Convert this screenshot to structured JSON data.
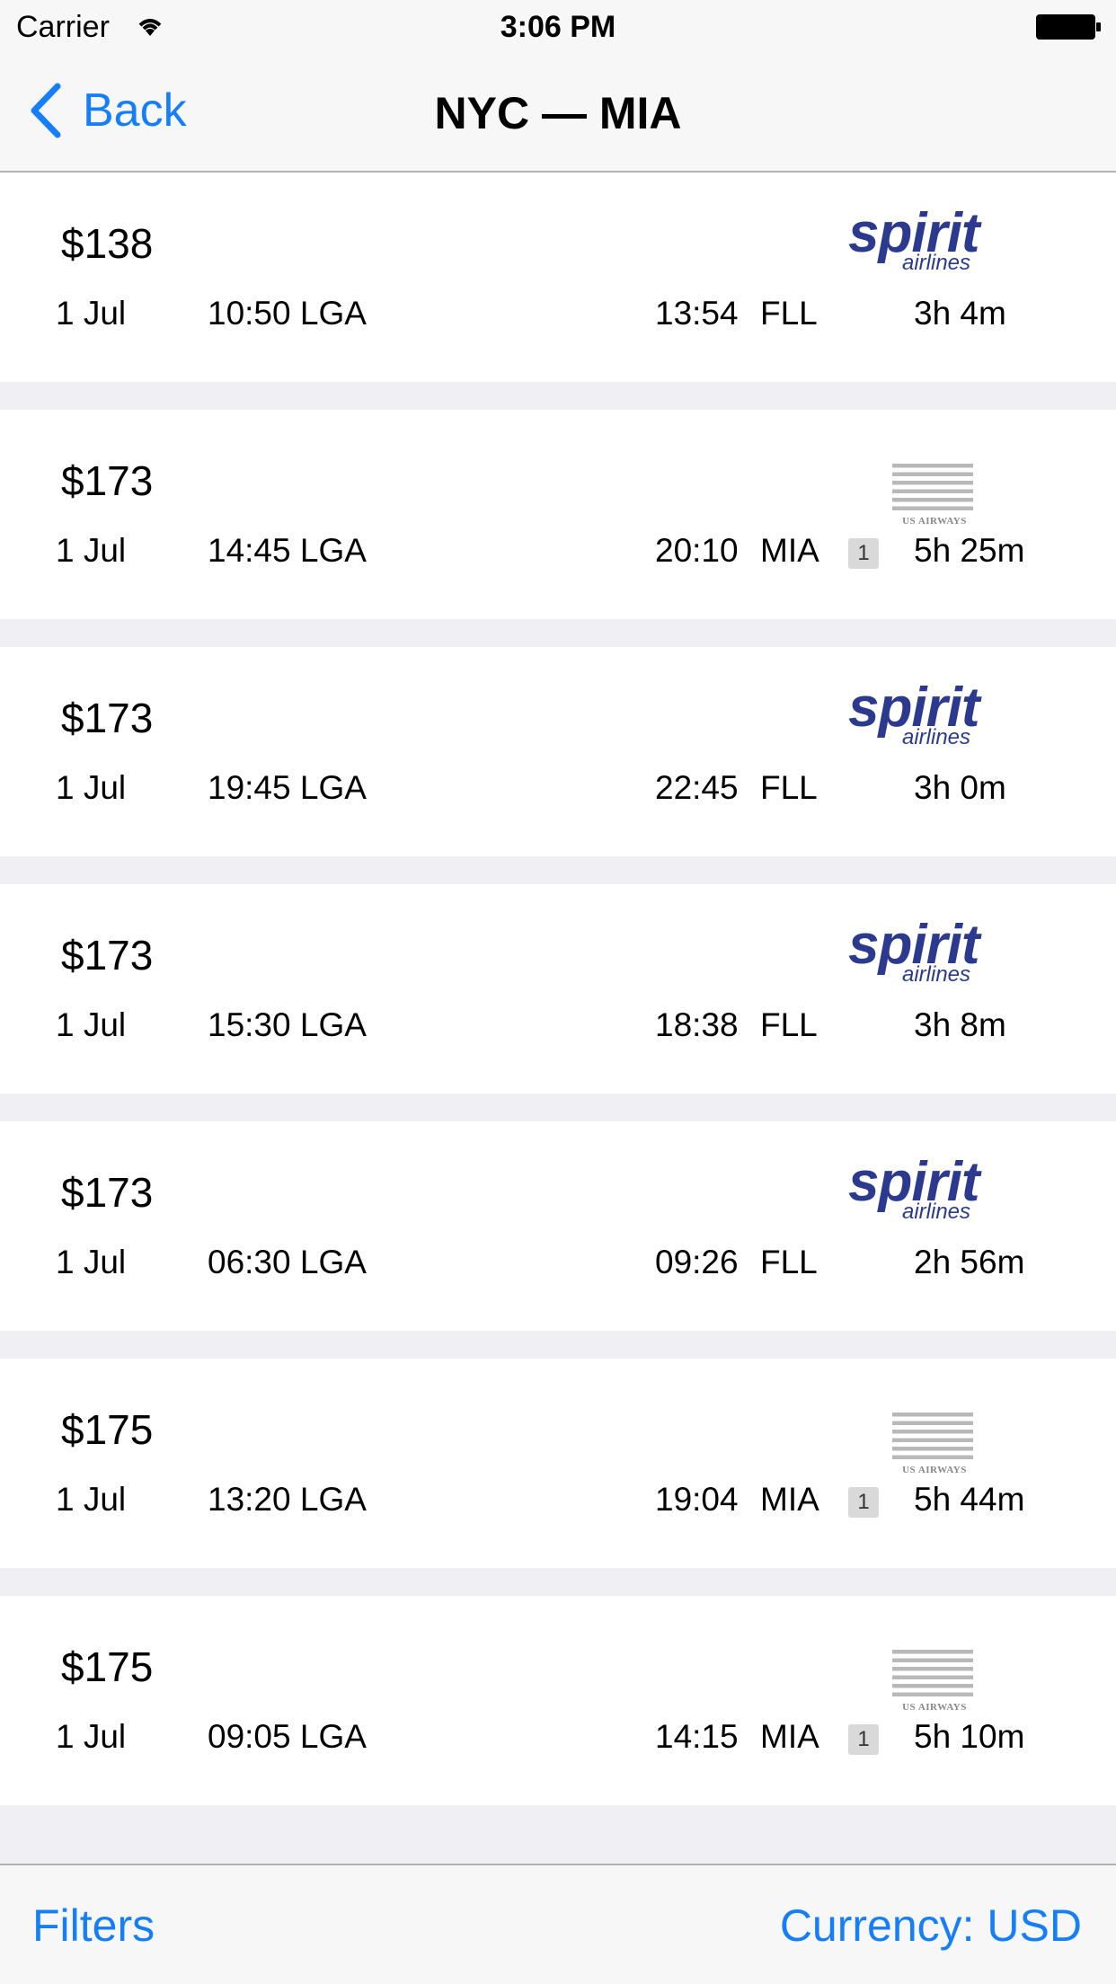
{
  "status_bar": {
    "carrier": "Carrier",
    "time": "3:06 PM"
  },
  "nav": {
    "back_label": "Back",
    "title": "NYC — MIA"
  },
  "flights": [
    {
      "price": "$138",
      "date": "1 Jul",
      "departure": "10:50 LGA",
      "arrival_time": "13:54",
      "arrival_airport": "FLL",
      "stops": "",
      "duration": "3h 4m",
      "airline": "spirit"
    },
    {
      "price": "$173",
      "date": "1 Jul",
      "departure": "14:45 LGA",
      "arrival_time": "20:10",
      "arrival_airport": "MIA",
      "stops": "1",
      "duration": "5h 25m",
      "airline": "usairways"
    },
    {
      "price": "$173",
      "date": "1 Jul",
      "departure": "19:45 LGA",
      "arrival_time": "22:45",
      "arrival_airport": "FLL",
      "stops": "",
      "duration": "3h 0m",
      "airline": "spirit"
    },
    {
      "price": "$173",
      "date": "1 Jul",
      "departure": "15:30 LGA",
      "arrival_time": "18:38",
      "arrival_airport": "FLL",
      "stops": "",
      "duration": "3h 8m",
      "airline": "spirit"
    },
    {
      "price": "$173",
      "date": "1 Jul",
      "departure": "06:30 LGA",
      "arrival_time": "09:26",
      "arrival_airport": "FLL",
      "stops": "",
      "duration": "2h 56m",
      "airline": "spirit"
    },
    {
      "price": "$175",
      "date": "1 Jul",
      "departure": "13:20 LGA",
      "arrival_time": "19:04",
      "arrival_airport": "MIA",
      "stops": "1",
      "duration": "5h 44m",
      "airline": "usairways"
    },
    {
      "price": "$175",
      "date": "1 Jul",
      "departure": "09:05 LGA",
      "arrival_time": "14:15",
      "arrival_airport": "MIA",
      "stops": "1",
      "duration": "5h 10m",
      "airline": "usairways"
    }
  ],
  "airline_logos": {
    "spirit": {
      "word": "spirit",
      "sub": "airlines",
      "color": "#2b3a8f"
    },
    "usairways": {
      "word": "US AIRWAYS",
      "color": "#888888"
    }
  },
  "toolbar": {
    "filters_label": "Filters",
    "currency_label": "Currency: USD"
  },
  "colors": {
    "accent": "#157efb",
    "background": "#efeff4"
  }
}
